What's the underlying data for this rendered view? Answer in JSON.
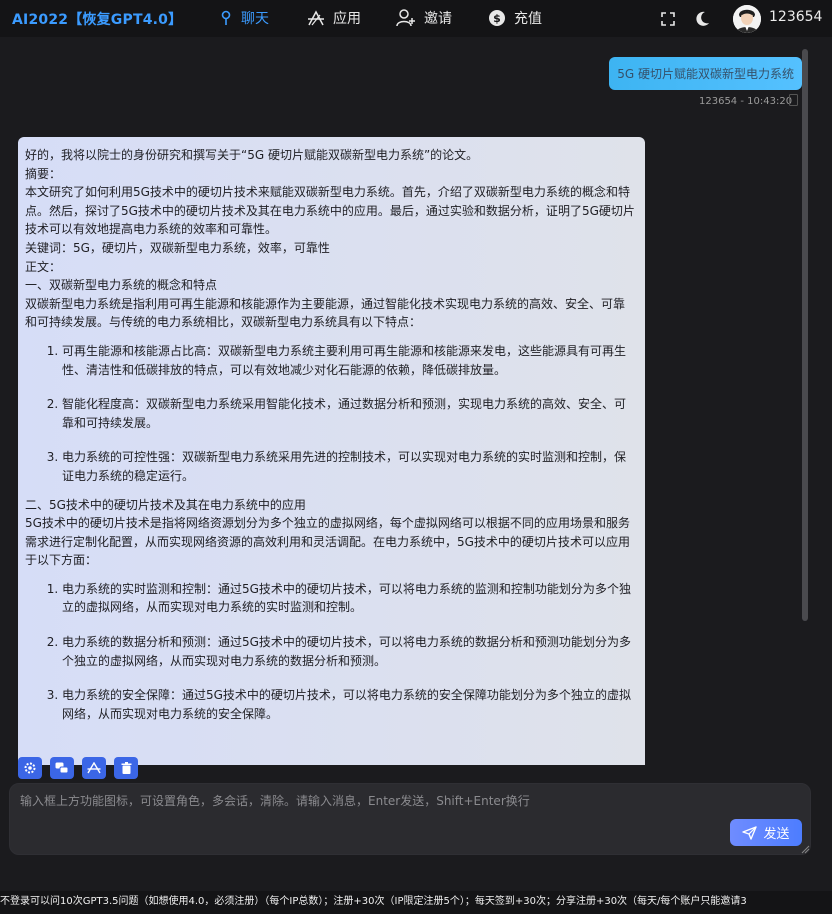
{
  "header": {
    "brand": "AI2022【恢复GPT4.0】",
    "nav": [
      {
        "label": "聊天",
        "icon": "pin-icon",
        "active": true
      },
      {
        "label": "应用",
        "icon": "app-icon",
        "active": false
      },
      {
        "label": "邀请",
        "icon": "invite-user-icon",
        "active": false
      },
      {
        "label": "充值",
        "icon": "dollar-icon",
        "active": false
      }
    ],
    "username": "123654",
    "accent_color": "#3b9bff"
  },
  "chat": {
    "user_message": "5G 硬切片赋能双碳新型电力系统",
    "user_meta": "123654 - 10:43:20",
    "bot": {
      "intro": "好的，我将以院士的身份研究和撰写关于“5G 硬切片赋能双碳新型电力系统”的论文。",
      "abstract_label": "摘要：",
      "abstract": "本文研究了如何利用5G技术中的硬切片技术来赋能双碳新型电力系统。首先，介绍了双碳新型电力系统的概念和特点。然后，探讨了5G技术中的硬切片技术及其在电力系统中的应用。最后，通过实验和数据分析，证明了5G硬切片技术可以有效地提高电力系统的效率和可靠性。",
      "keywords": "关键词：5G，硬切片，双碳新型电力系统，效率，可靠性",
      "body_label": "正文：",
      "section1_title": "一、双碳新型电力系统的概念和特点",
      "section1_text": "双碳新型电力系统是指利用可再生能源和核能源作为主要能源，通过智能化技术实现电力系统的高效、安全、可靠和可持续发展。与传统的电力系统相比，双碳新型电力系统具有以下特点：",
      "section1_items": [
        "可再生能源和核能源占比高：双碳新型电力系统主要利用可再生能源和核能源来发电，这些能源具有可再生性、清洁性和低碳排放的特点，可以有效地减少对化石能源的依赖，降低碳排放量。",
        "智能化程度高：双碳新型电力系统采用智能化技术，通过数据分析和预测，实现电力系统的高效、安全、可靠和可持续发展。",
        "电力系统的可控性强：双碳新型电力系统采用先进的控制技术，可以实现对电力系统的实时监测和控制，保证电力系统的稳定运行。"
      ],
      "section2_title": "二、5G技术中的硬切片技术及其在电力系统中的应用",
      "section2_text": "5G技术中的硬切片技术是指将网络资源划分为多个独立的虚拟网络，每个虚拟网络可以根据不同的应用场景和服务需求进行定制化配置，从而实现网络资源的高效利用和灵活调配。在电力系统中，5G技术中的硬切片技术可以应用于以下方面：",
      "section2_items": [
        "电力系统的实时监测和控制：通过5G技术中的硬切片技术，可以将电力系统的监测和控制功能划分为多个独立的虚拟网络，从而实现对电力系统的实时监测和控制。",
        "电力系统的数据分析和预测：通过5G技术中的硬切片技术，可以将电力系统的数据分析和预测功能划分为多个独立的虚拟网络，从而实现对电力系统的数据分析和预测。",
        "电力系统的安全保障：通过5G技术中的硬切片技术，可以将电力系统的安全保障功能划分为多个独立的虚拟网络，从而实现对电力系统的安全保障。"
      ]
    },
    "tools": [
      {
        "name": "settings-icon"
      },
      {
        "name": "multi-chat-icon"
      },
      {
        "name": "app-icon"
      },
      {
        "name": "trash-icon"
      }
    ]
  },
  "input": {
    "placeholder": "输入框上方功能图标，可设置角色，多会话，清除。请输入消息，Enter发送，Shift+Enter换行",
    "send_label": "发送"
  },
  "footer": {
    "notice": "不登录可以问10次GPT3.5问题（如想使用4.0，必须注册）（每个IP总数）；注册+30次（IP限定注册5个）；每天签到+30次；分享注册+30次（每天/每个账户只能邀请3"
  }
}
